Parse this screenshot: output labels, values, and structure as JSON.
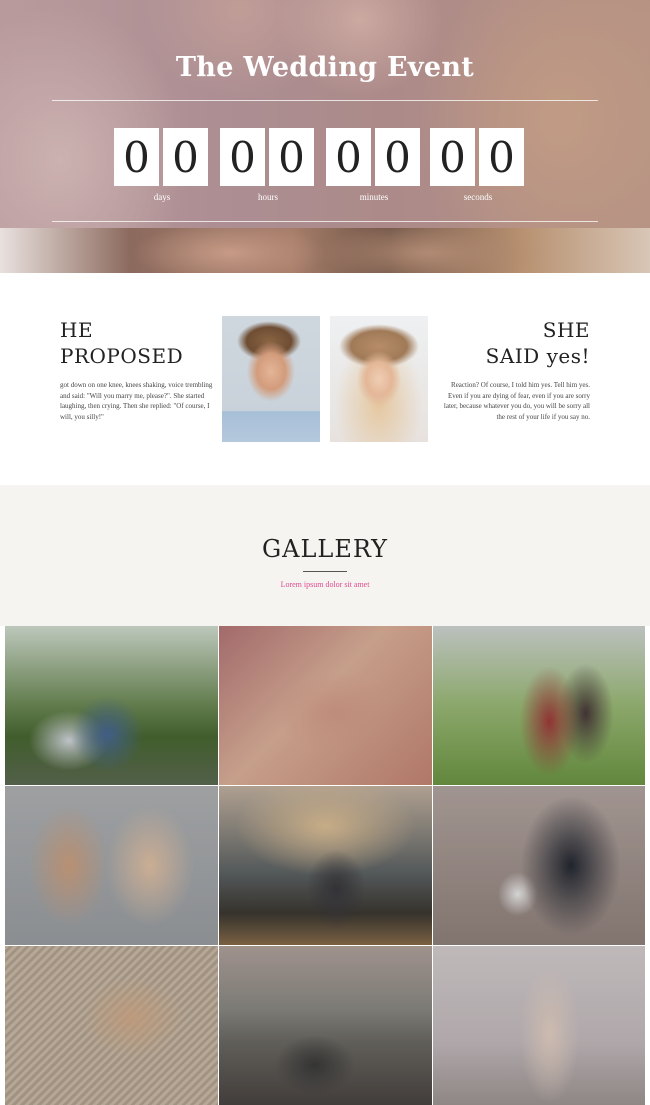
{
  "hero": {
    "title": "The Wedding Event",
    "countdown": [
      {
        "digits": [
          "0",
          "0"
        ],
        "label": "days"
      },
      {
        "digits": [
          "0",
          "0"
        ],
        "label": "hours"
      },
      {
        "digits": [
          "0",
          "0"
        ],
        "label": "minutes"
      },
      {
        "digits": [
          "0",
          "0"
        ],
        "label": "seconds"
      }
    ]
  },
  "couple": {
    "he": {
      "title_line1": "HE",
      "title_line2": "PROPOSED",
      "text": "got down on one knee, knees shaking, voice trembling and said: \"Will you marry me, please?\". She started laughing, then crying. Then she replied: \"Of course, I will, you silly!\""
    },
    "she": {
      "title_line1": "SHE",
      "title_line2": "SAID yes!",
      "text": "Reaction? Of course, I told him yes. Tell him yes. Even if you are dying of fear, even if you are sorry later, because whatever you do, you will be sorry all the rest of your life if you say no."
    }
  },
  "gallery": {
    "title": "GALLERY",
    "subtitle": "Lorem ipsum dolor sit amet"
  }
}
